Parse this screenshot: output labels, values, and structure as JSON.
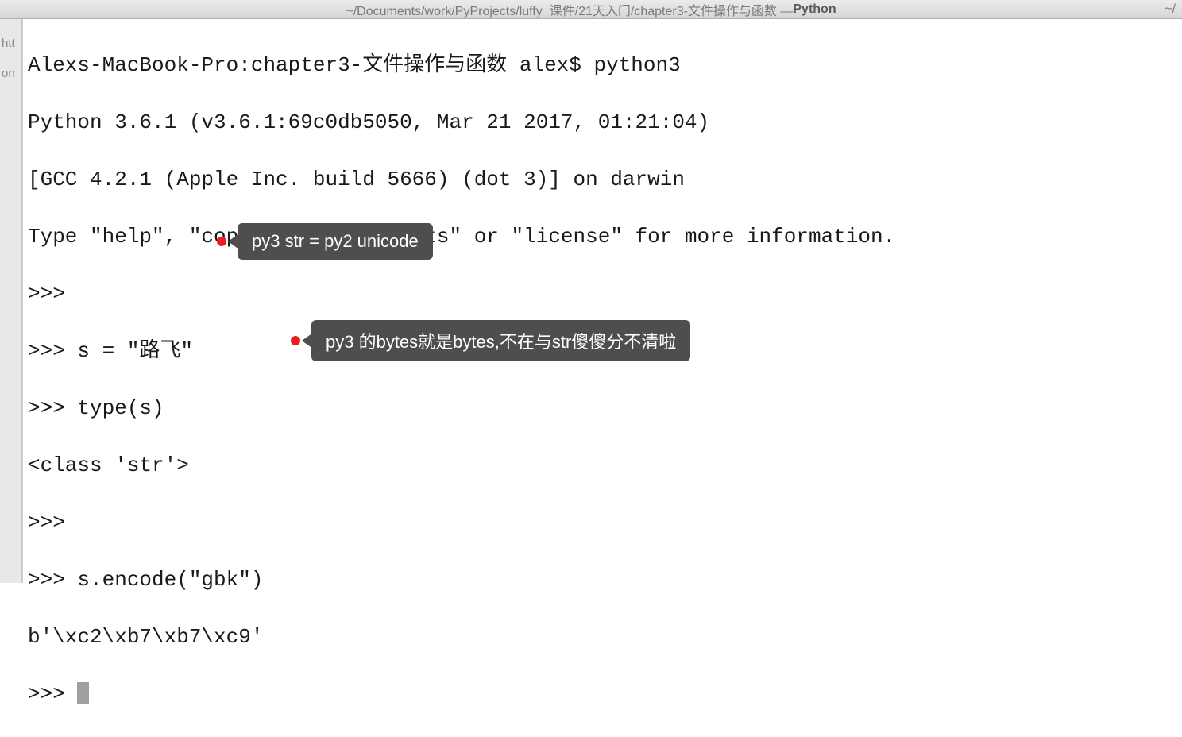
{
  "titleBar": {
    "path": "~/Documents/work/PyProjects/luffy_课件/21天入门/chapter3-文件操作与函数 — ",
    "boldPart": "Python",
    "rightHome": "~/"
  },
  "sidebar": {
    "text1": "htt",
    "text2": "on"
  },
  "terminal": {
    "lines": [
      "Alexs-MacBook-Pro:chapter3-文件操作与函数 alex$ python3",
      "Python 3.6.1 (v3.6.1:69c0db5050, Mar 21 2017, 01:21:04) ",
      "[GCC 4.2.1 (Apple Inc. build 5666) (dot 3)] on darwin",
      "Type \"help\", \"copyright\", \"credits\" or \"license\" for more information.",
      ">>> ",
      ">>> s = \"路飞\"",
      ">>> type(s)",
      "<class 'str'>",
      ">>> ",
      ">>> s.encode(\"gbk\")",
      "b'\\xc2\\xb7\\xb7\\xc9'",
      ">>> "
    ]
  },
  "annotations": {
    "note1": "py3 str = py2 unicode",
    "note2": "py3 的bytes就是bytes,不在与str傻傻分不清啦"
  }
}
